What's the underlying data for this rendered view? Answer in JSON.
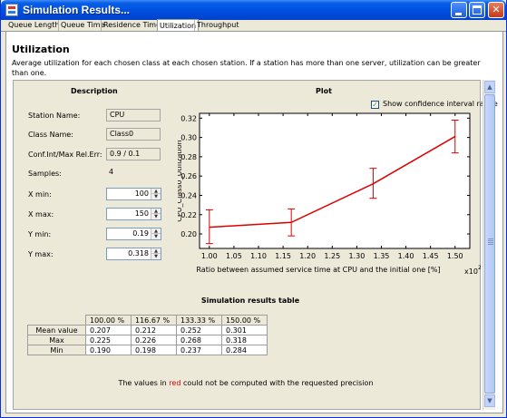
{
  "window": {
    "title": "Simulation Results..."
  },
  "tabs": [
    {
      "label": "Queue Length"
    },
    {
      "label": "Queue Time"
    },
    {
      "label": "Residence Time"
    },
    {
      "label": "Utilization",
      "active": true
    },
    {
      "label": "Throughput"
    }
  ],
  "header": {
    "title": "Utilization",
    "description": "Average utilization for each chosen class at each chosen station. If a station has more than one server, utilization can be greater than one."
  },
  "description_panel": {
    "title": "Description",
    "station_name_label": "Station Name:",
    "station_name": "CPU",
    "class_name_label": "Class Name:",
    "class_name": "Class0",
    "conf_label": "Conf.Int/Max Rel.Err:",
    "conf_value": "0.9 / 0.1",
    "samples_label": "Samples:",
    "samples_value": "4",
    "xmin_label": "X min:",
    "xmin": "100",
    "xmax_label": "X max:",
    "xmax": "150",
    "ymin_label": "Y min:",
    "ymin": "0.19",
    "ymax_label": "Y max:",
    "ymax": "0.318"
  },
  "plot": {
    "title": "Plot",
    "show_ci_label": "Show confidence interval range",
    "show_ci_checked": true
  },
  "chart_data": {
    "type": "line",
    "x": [
      1.0,
      1.1667,
      1.3333,
      1.5
    ],
    "series": [
      {
        "values": [
          0.207,
          0.212,
          0.252,
          0.301
        ],
        "upper": [
          0.225,
          0.226,
          0.268,
          0.318
        ],
        "lower": [
          0.19,
          0.198,
          0.237,
          0.284
        ],
        "color": "#dd0000"
      }
    ],
    "xlabel": "Ratio between assumed service time at CPU and the initial one [%]",
    "x_multiplier": "x10",
    "x_multiplier_exp": "2",
    "ylabel": "CPU_Class0_Utilization",
    "xlim": [
      0.98,
      1.53
    ],
    "ylim": [
      0.185,
      0.325
    ],
    "xticks": [
      "1.00",
      "1.05",
      "1.10",
      "1.15",
      "1.20",
      "1.25",
      "1.30",
      "1.35",
      "1.40",
      "1.45",
      "1.50"
    ],
    "yticks": [
      "0.20",
      "0.22",
      "0.24",
      "0.26",
      "0.28",
      "0.30",
      "0.32"
    ],
    "grid": false
  },
  "results_table": {
    "title": "Simulation results table",
    "columns": [
      "100.00 %",
      "116.67 %",
      "133.33 %",
      "150.00 %"
    ],
    "rows": [
      {
        "label": "Mean value",
        "values": [
          "0.207",
          "0.212",
          "0.252",
          "0.301"
        ]
      },
      {
        "label": "Max",
        "values": [
          "0.225",
          "0.226",
          "0.268",
          "0.318"
        ]
      },
      {
        "label": "Min",
        "values": [
          "0.190",
          "0.198",
          "0.237",
          "0.284"
        ]
      }
    ]
  },
  "footnote": {
    "before": "The values in",
    "red_word": "red",
    "after": "could not be computed with the requested precision"
  },
  "colors": {
    "accent": "#dd0000",
    "title_bar": "#0054e3"
  }
}
